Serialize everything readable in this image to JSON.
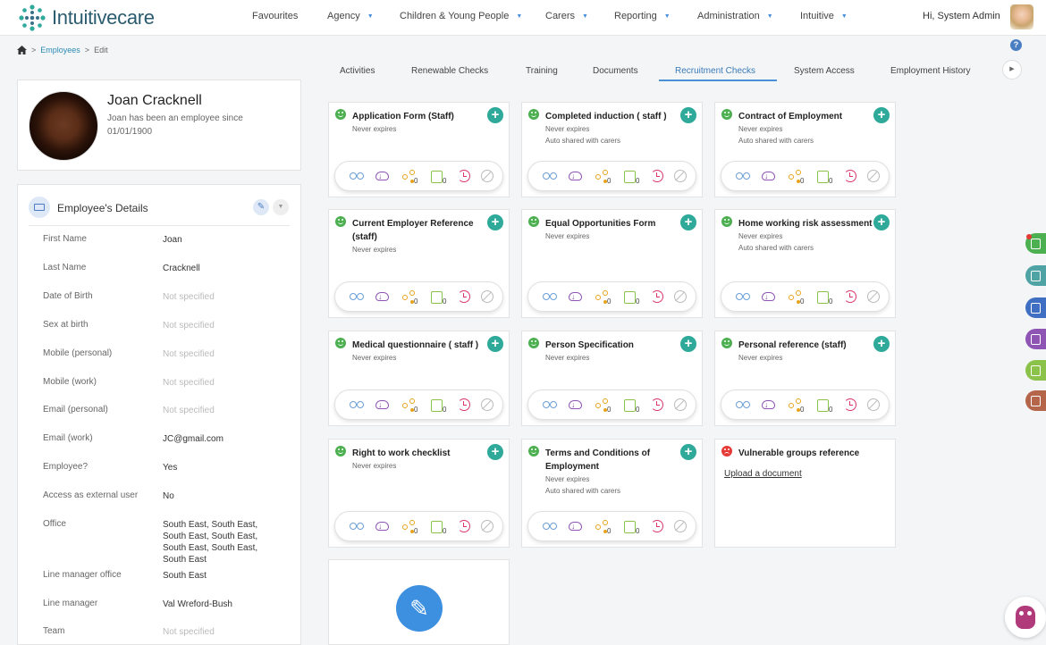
{
  "app": {
    "logo_text": "Intuitivecare",
    "greeting": "Hi, System Admin"
  },
  "nav": [
    {
      "label": "Favourites",
      "dropdown": false
    },
    {
      "label": "Agency",
      "dropdown": true
    },
    {
      "label": "Children & Young People",
      "dropdown": true
    },
    {
      "label": "Carers",
      "dropdown": true
    },
    {
      "label": "Reporting",
      "dropdown": true
    },
    {
      "label": "Administration",
      "dropdown": true
    },
    {
      "label": "Intuitive",
      "dropdown": true
    }
  ],
  "breadcrumb": {
    "link": "Employees",
    "current": "Edit",
    "sep": ">"
  },
  "help_label": "?",
  "tabs": [
    "Activities",
    "Renewable Checks",
    "Training",
    "Documents",
    "Recruitment Checks",
    "System Access",
    "Employment History"
  ],
  "active_tab": "Recruitment Checks",
  "profile": {
    "name": "Joan Cracknell",
    "subtitle": "Joan has been an employee since 01/01/1900"
  },
  "details": {
    "title": "Employee's Details",
    "rows": [
      {
        "label": "First Name",
        "value": "Joan",
        "ns": false
      },
      {
        "label": "Last Name",
        "value": "Cracknell",
        "ns": false
      },
      {
        "label": "Date of Birth",
        "value": "Not specified",
        "ns": true
      },
      {
        "label": "Sex at birth",
        "value": "Not specified",
        "ns": true
      },
      {
        "label": "Mobile (personal)",
        "value": "Not specified",
        "ns": true
      },
      {
        "label": "Mobile (work)",
        "value": "Not specified",
        "ns": true
      },
      {
        "label": "Email (personal)",
        "value": "Not specified",
        "ns": true
      },
      {
        "label": "Email (work)",
        "value": "JC@gmail.com",
        "ns": false
      },
      {
        "label": "Employee?",
        "value": "Yes",
        "ns": false
      },
      {
        "label": "Access as external user",
        "value": "No",
        "ns": false
      },
      {
        "label": "Office",
        "value": "South East, South East, South East, South East, South East, South East, South East",
        "ns": false
      },
      {
        "label": "Line manager office",
        "value": "South East",
        "ns": false
      },
      {
        "label": "Line manager",
        "value": "Val Wreford-Bush",
        "ns": false
      },
      {
        "label": "Team",
        "value": "Not specified",
        "ns": true
      }
    ]
  },
  "checks": [
    {
      "title": "Application Form (Staff)",
      "lines": [
        "Never expires"
      ],
      "status": "ok",
      "count_share": "0",
      "count_note": "0"
    },
    {
      "title": "Completed induction ( staff )",
      "lines": [
        "Never expires",
        "Auto shared with carers"
      ],
      "status": "ok",
      "count_share": "0",
      "count_note": "0"
    },
    {
      "title": "Contract of Employment",
      "lines": [
        "Never expires",
        "Auto shared with carers"
      ],
      "status": "ok",
      "count_share": "0",
      "count_note": "0"
    },
    {
      "title": "Current Employer Reference (staff)",
      "lines": [
        "Never expires"
      ],
      "status": "ok",
      "count_share": "0",
      "count_note": "0"
    },
    {
      "title": "Equal Opportunities Form",
      "lines": [
        "Never expires"
      ],
      "status": "ok",
      "count_share": "0",
      "count_note": "0"
    },
    {
      "title": "Home working risk assessment",
      "lines": [
        "Never expires",
        "Auto shared with carers"
      ],
      "status": "ok",
      "count_share": "0",
      "count_note": "0"
    },
    {
      "title": "Medical questionnaire ( staff )",
      "lines": [
        "Never expires"
      ],
      "status": "ok",
      "count_share": "0",
      "count_note": "0"
    },
    {
      "title": "Person Specification",
      "lines": [
        "Never expires"
      ],
      "status": "ok",
      "count_share": "0",
      "count_note": "0"
    },
    {
      "title": "Personal reference (staff)",
      "lines": [
        "Never expires"
      ],
      "status": "ok",
      "count_share": "0",
      "count_note": "0"
    },
    {
      "title": "Right to work checklist",
      "lines": [
        "Never expires"
      ],
      "status": "ok",
      "count_share": "0",
      "count_note": "0"
    },
    {
      "title": "Terms and Conditions of Employment",
      "lines": [
        "Never expires",
        "Auto shared with carers"
      ],
      "status": "ok",
      "count_share": "0",
      "count_note": "0"
    },
    {
      "title": "Vulnerable groups reference",
      "lines": [],
      "status": "missing",
      "upload_label": "Upload a document"
    }
  ],
  "side_icons": [
    {
      "name": "list-icon",
      "color": "#4caf50"
    },
    {
      "name": "briefcase-icon",
      "color": "#4fa3a5"
    },
    {
      "name": "document-icon",
      "color": "#3f6fc2"
    },
    {
      "name": "person-icon",
      "color": "#8e55b5"
    },
    {
      "name": "calendar-icon",
      "color": "#8bc34a"
    },
    {
      "name": "stamp-icon",
      "color": "#b5654a"
    }
  ],
  "colors": {
    "accent": "#4a90d9",
    "add": "#2ea99a",
    "ok": "#4caf50",
    "bad": "#e53935"
  }
}
